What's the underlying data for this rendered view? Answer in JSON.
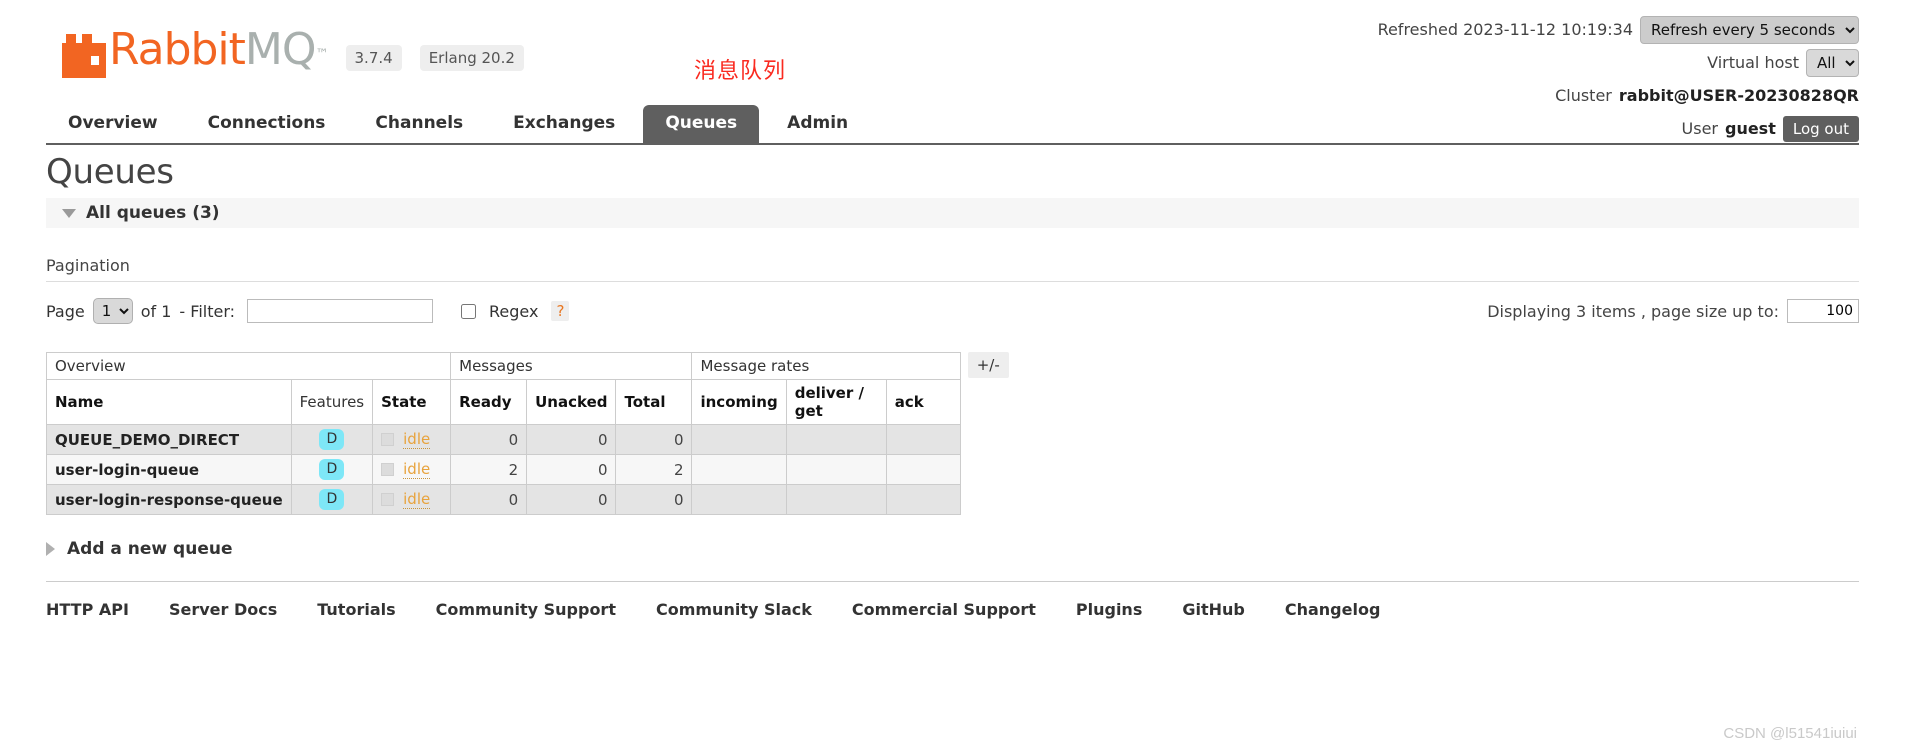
{
  "brand": {
    "name_part1": "Rabbit",
    "name_part2": "MQ",
    "trademark": "™",
    "version": "3.7.4",
    "erlang": "Erlang 20.2"
  },
  "annotation": {
    "text": "消息队列",
    "color": "#fa2a20"
  },
  "header": {
    "refreshed_label": "Refreshed 2023-11-12 10:19:34",
    "refresh_select": "Refresh every 5 seconds",
    "vhost_label": "Virtual host",
    "vhost_value": "All",
    "cluster_label": "Cluster",
    "cluster_value": "rabbit@USER-20230828QR",
    "user_label": "User",
    "user_value": "guest",
    "logout_label": "Log out"
  },
  "tabs": [
    {
      "label": "Overview",
      "active": false
    },
    {
      "label": "Connections",
      "active": false
    },
    {
      "label": "Channels",
      "active": false
    },
    {
      "label": "Exchanges",
      "active": false
    },
    {
      "label": "Queues",
      "active": true
    },
    {
      "label": "Admin",
      "active": false
    }
  ],
  "page": {
    "title": "Queues",
    "section_label": "All queues (3)",
    "pagination_label": "Pagination"
  },
  "pagination": {
    "page_label": "Page",
    "page_value": "1",
    "of_label": "of 1",
    "filter_label": "- Filter:",
    "filter_value": "",
    "filter_placeholder": "",
    "regex_label": "Regex",
    "help_label": "?",
    "displaying_label": "Displaying 3 items , page size up to:",
    "page_size_value": "100"
  },
  "table": {
    "group_headers": [
      {
        "label": "Overview",
        "span": 3
      },
      {
        "label": "Messages",
        "span": 3
      },
      {
        "label": "Message rates",
        "span": 3
      }
    ],
    "columns": [
      {
        "label": "Name",
        "sortable": true,
        "align": "left"
      },
      {
        "label": "Features",
        "sortable": false,
        "align": "left"
      },
      {
        "label": "State",
        "sortable": true,
        "align": "left"
      },
      {
        "label": "Ready",
        "sortable": true,
        "align": "right"
      },
      {
        "label": "Unacked",
        "sortable": true,
        "align": "right"
      },
      {
        "label": "Total",
        "sortable": true,
        "align": "right"
      },
      {
        "label": "incoming",
        "sortable": true,
        "align": "left"
      },
      {
        "label": "deliver / get",
        "sortable": true,
        "align": "left"
      },
      {
        "label": "ack",
        "sortable": true,
        "align": "left"
      }
    ],
    "toggle_label": "+/-",
    "rows": [
      {
        "name": "QUEUE_DEMO_DIRECT",
        "feature": "D",
        "state": "idle",
        "ready": "0",
        "unacked": "0",
        "total": "0",
        "incoming": "",
        "deliver_get": "",
        "ack": ""
      },
      {
        "name": "user-login-queue",
        "feature": "D",
        "state": "idle",
        "ready": "2",
        "unacked": "0",
        "total": "2",
        "incoming": "",
        "deliver_get": "",
        "ack": ""
      },
      {
        "name": "user-login-response-queue",
        "feature": "D",
        "state": "idle",
        "ready": "0",
        "unacked": "0",
        "total": "0",
        "incoming": "",
        "deliver_get": "",
        "ack": ""
      }
    ]
  },
  "add_queue": {
    "label": "Add a new queue"
  },
  "footer": {
    "links": [
      "HTTP API",
      "Server Docs",
      "Tutorials",
      "Community Support",
      "Community Slack",
      "Commercial Support",
      "Plugins",
      "GitHub",
      "Changelog"
    ]
  },
  "watermark": {
    "text": "CSDN @l51541iuiui"
  },
  "colors": {
    "brand_orange": "#f26522",
    "brand_gray": "#a9b0ae",
    "active_tab": "#5f5f5f",
    "feature_badge": "#7ee7f7",
    "state_idle": "#e8a33d"
  }
}
